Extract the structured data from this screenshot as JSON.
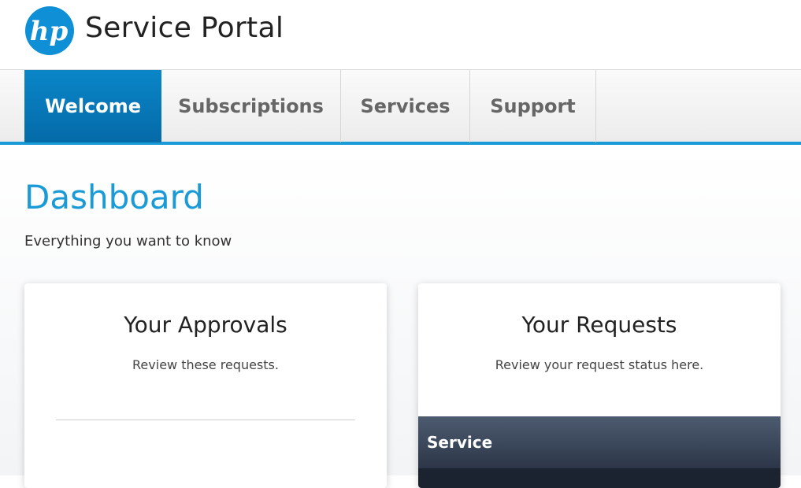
{
  "header": {
    "logo_text": "hp",
    "title": "Service Portal"
  },
  "nav": {
    "tabs": [
      {
        "label": "Welcome",
        "active": true
      },
      {
        "label": "Subscriptions",
        "active": false
      },
      {
        "label": "Services",
        "active": false
      },
      {
        "label": "Support",
        "active": false
      }
    ]
  },
  "main": {
    "title": "Dashboard",
    "subtitle": "Everything you want to know",
    "cards": [
      {
        "title": "Your Approvals",
        "description": "Review these requests."
      },
      {
        "title": "Your Requests",
        "description": "Review your request status here.",
        "table_header": "Service"
      }
    ]
  },
  "colors": {
    "accent": "#1a9ad6",
    "active_tab": "#0a7bc0",
    "table_header": "#3a4559"
  }
}
